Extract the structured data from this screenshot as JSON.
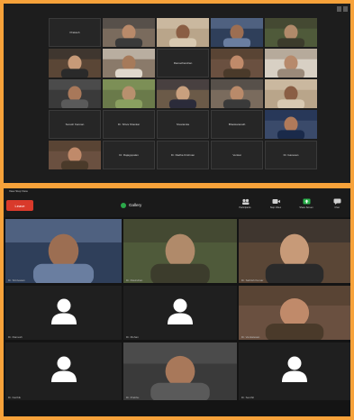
{
  "app": {
    "colors": {
      "background": "#f7a23a",
      "leave": "#d93a2b",
      "active_speaker": "#2bb24c"
    }
  },
  "top_gallery": {
    "tiles": [
      {
        "type": "name",
        "name": "Prakash"
      },
      {
        "type": "video",
        "name": ""
      },
      {
        "type": "video",
        "name": ""
      },
      {
        "type": "video",
        "name": ""
      },
      {
        "type": "video",
        "name": ""
      },
      {
        "type": "video",
        "name": ""
      },
      {
        "type": "video",
        "name": ""
      },
      {
        "type": "name",
        "name": "Ramachandran"
      },
      {
        "type": "video",
        "name": ""
      },
      {
        "type": "video",
        "name": ""
      },
      {
        "type": "video",
        "name": ""
      },
      {
        "type": "video",
        "name": ""
      },
      {
        "type": "video",
        "name": ""
      },
      {
        "type": "video",
        "name": ""
      },
      {
        "type": "video",
        "name": ""
      },
      {
        "type": "name",
        "name": "Suresh Kannan"
      },
      {
        "type": "name",
        "name": "Dr. Shiva Shankar"
      },
      {
        "type": "name",
        "name": "Sivaramka"
      },
      {
        "type": "name",
        "name": "Bhaskaranath"
      },
      {
        "type": "video",
        "name": ""
      },
      {
        "type": "video",
        "name": ""
      },
      {
        "type": "name",
        "name": "Dr. Rajagopalan"
      },
      {
        "type": "name",
        "name": "Dr. Radha Krishnan"
      },
      {
        "type": "name",
        "name": "Venkat"
      },
      {
        "type": "name",
        "name": "Dr. Ganesan"
      }
    ]
  },
  "bottom": {
    "status": "View  Stop View",
    "leave_label": "Leave",
    "view_label": "Gallery",
    "toolbar_items": [
      {
        "label": "Participants",
        "icon": "participants-icon"
      },
      {
        "label": "Stop Video",
        "icon": "video-icon"
      },
      {
        "label": "Share Screen",
        "icon": "share-icon"
      },
      {
        "label": "Chat",
        "icon": "chat-icon"
      }
    ],
    "tiles": [
      {
        "kind": "video",
        "name": "Dr. Srinivasan",
        "active": false
      },
      {
        "kind": "video",
        "name": "Dr. Ravindran",
        "active": false
      },
      {
        "kind": "video",
        "name": "Dr. Sathish Kumar",
        "active": true
      },
      {
        "kind": "avatar",
        "name": "Dr. Ramesh",
        "active": false
      },
      {
        "kind": "avatar",
        "name": "Dr. Mohan",
        "active": false
      },
      {
        "kind": "video",
        "name": "Dr. Venkatesan",
        "active": false
      },
      {
        "kind": "avatar",
        "name": "Dr. Karthik",
        "active": false
      },
      {
        "kind": "video",
        "name": "Dr. Prabhu",
        "active": false
      },
      {
        "kind": "avatar",
        "name": "Dr. Senthil",
        "active": false
      }
    ]
  }
}
